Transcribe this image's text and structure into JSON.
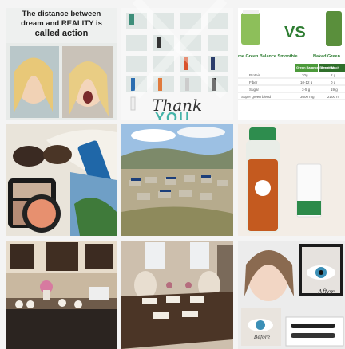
{
  "posts": {
    "dream": {
      "line1": "The distance between",
      "line2": "dream and REALITY is",
      "line3": "called action"
    },
    "thank": {
      "thank": "Thank",
      "you": "YOU"
    },
    "compare": {
      "vs": "VS",
      "left": "me Green Balance Smoothie",
      "right": "Naked Green",
      "header_left": "Green Balance Smoothie",
      "header_right": "Green Mach",
      "rows": [
        {
          "label": "Protein",
          "a": "20g",
          "b": "2 g"
        },
        {
          "label": "Fiber",
          "a": "10-12 g",
          "b": "0 g"
        },
        {
          "label": "Sugar",
          "a": "3-5 g",
          "b": "19 g"
        },
        {
          "label": "Super green blend",
          "a": "3600 mg",
          "b": "2100 m"
        }
      ]
    },
    "lashes": {
      "after": "After",
      "before": "Before"
    }
  },
  "colors": {
    "accent_green": "#2e7d32",
    "teal": "#44b3a8"
  }
}
